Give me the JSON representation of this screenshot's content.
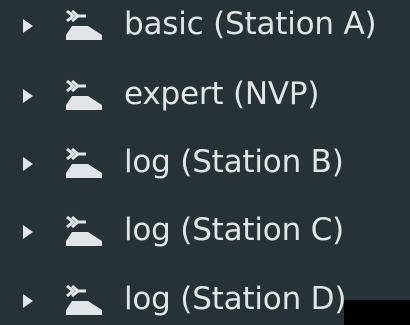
{
  "colors": {
    "background": "#263238",
    "text": "#dfe5e8",
    "icon": "#dfe5e8",
    "overlay": "#000000"
  },
  "tree": {
    "items": [
      {
        "label": "basic (Station A)",
        "icon": "import-station-icon",
        "expander": "caret-right-icon"
      },
      {
        "label": "expert (NVP)",
        "icon": "import-station-icon",
        "expander": "caret-right-icon"
      },
      {
        "label": "log (Station B)",
        "icon": "import-station-icon",
        "expander": "caret-right-icon"
      },
      {
        "label": "log (Station C)",
        "icon": "import-station-icon",
        "expander": "caret-right-icon"
      },
      {
        "label": "log (Station D)",
        "icon": "import-station-icon",
        "expander": "caret-right-icon"
      }
    ]
  }
}
